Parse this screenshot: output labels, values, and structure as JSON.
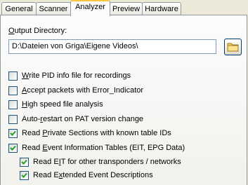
{
  "tabs": [
    {
      "label": "General",
      "active": false
    },
    {
      "label": "Scanner",
      "active": false
    },
    {
      "label": "Analyzer",
      "active": true
    },
    {
      "label": "Preview",
      "active": false
    },
    {
      "label": "Hardware",
      "active": false
    }
  ],
  "output_directory": {
    "label_mnemonic": "O",
    "label_rest": "utput Directory:",
    "value": "D:\\Dateien von Griga\\Eigene Videos\\",
    "browse_icon": "folder-icon"
  },
  "options": [
    {
      "pre": "",
      "key": "W",
      "post": "rite PID info file for recordings",
      "checked": false
    },
    {
      "pre": "",
      "key": "A",
      "post": "ccept packets with Error_Indicator",
      "checked": false
    },
    {
      "pre": "",
      "key": "H",
      "post": "igh speed file analysis",
      "checked": false
    },
    {
      "pre": "Auto-",
      "key": "r",
      "post": "estart on PAT version change",
      "checked": false
    },
    {
      "pre": "Read ",
      "key": "P",
      "post": "rivate Sections with known table IDs",
      "checked": true
    },
    {
      "pre": "Read ",
      "key": "E",
      "post": "vent Information Tables (EIT, EPG Data)",
      "checked": true
    },
    {
      "pre": "Read E",
      "key": "I",
      "post": "T for other transponders / networks",
      "checked": true
    },
    {
      "pre": "Read E",
      "key": "x",
      "post": "tended Event Descriptions",
      "checked": true
    }
  ],
  "colors": {
    "checkmark": "#21a121",
    "active_tab_accent": "#ffc83c"
  }
}
